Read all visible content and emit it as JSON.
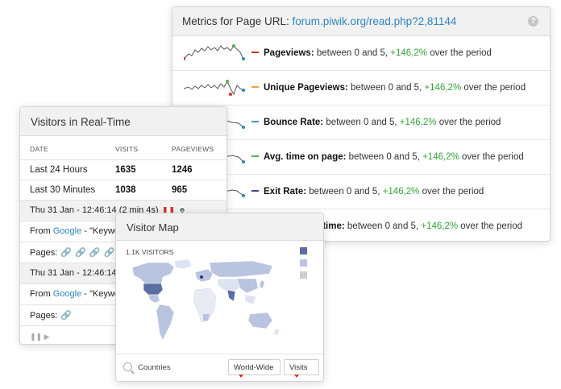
{
  "metrics": {
    "title": "Metrics for Page URL: ",
    "url": "forum.piwik.org/read.php?2,81144",
    "help_icon": "question-icon",
    "rows": [
      {
        "name": "Pageviews:",
        "color": "#d9322a",
        "pre": " between 0 and 5, ",
        "change": "+146,2%",
        "post": " over the period"
      },
      {
        "name": "Unique Pageviews:",
        "color": "#f0a33a",
        "pre": " between 0 and 5, ",
        "change": "+146,2%",
        "post": " over the period"
      },
      {
        "name": "Bounce Rate:",
        "color": "#4a90d9",
        "pre": " between 0 and 5, ",
        "change": "+146,2%",
        "post": " over the period"
      },
      {
        "name": "Avg. time on page:",
        "color": "#4caf50",
        "pre": " between 0 and 5, ",
        "change": "+146,2%",
        "post": " over the period"
      },
      {
        "name": "Exit Rate:",
        "color": "#3a4f8a",
        "pre": " between 0 and 5, ",
        "change": "+146,2%",
        "post": " over the period"
      },
      {
        "name": "n time:",
        "color": "#3a4f8a",
        "pre": " between 0 and 5, ",
        "change": "+146,2%",
        "post": " over the period"
      }
    ]
  },
  "realtime": {
    "title": "Visitors in Real-Time",
    "columns": [
      "DATE",
      "VISITS",
      "PAGEVIEWS"
    ],
    "rows": [
      {
        "date": "Last 24 Hours",
        "visits": "1635",
        "pageviews": "1246"
      },
      {
        "date": "Last 30 Minutes",
        "visits": "1038",
        "pageviews": "965"
      }
    ],
    "visits": [
      {
        "time": "Thu 31 Jan - 12:46:14 (2 min 4s)",
        "from_label": "From ",
        "referrer": "Google",
        "keyword": " - \"Keywor",
        "pages_label": "Pages: "
      },
      {
        "time": "Thu 31 Jan - 12:46:14 (",
        "from_label": "From ",
        "referrer": "Google",
        "keyword": " - \"Keywo",
        "pages_label": "Pages: "
      }
    ],
    "controls": "❚❚ ▶"
  },
  "visitor_map": {
    "title": "Visitor Map",
    "visitors_label": "1.1K VISITORS",
    "legend_colors": [
      "#5a6ea3",
      "#b8c4e0",
      "#cfcfcf"
    ],
    "footer": {
      "countries_label": "Countries",
      "region_select": "World-Wide",
      "metric_select": "Visits"
    }
  }
}
